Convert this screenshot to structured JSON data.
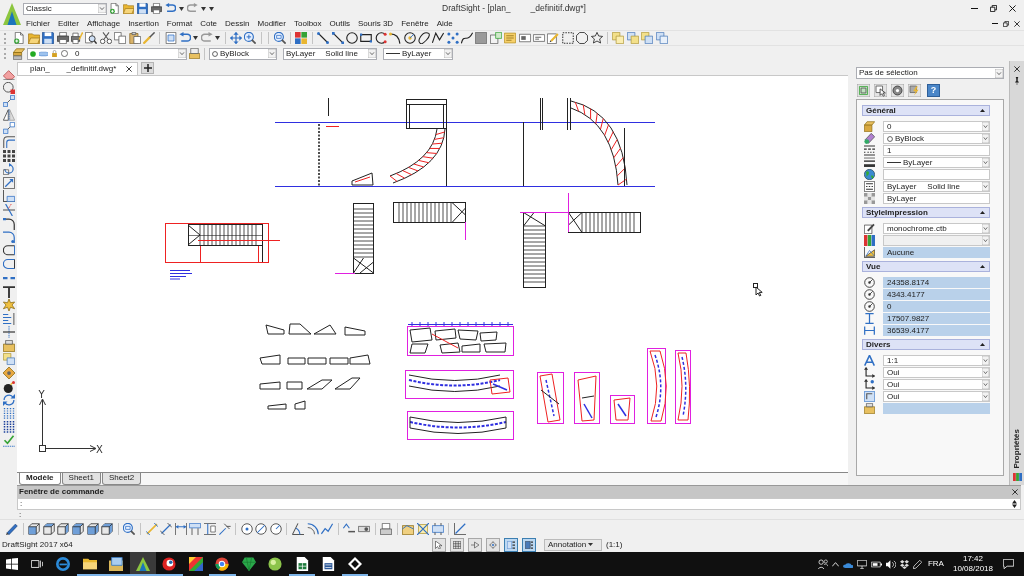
{
  "title_bar": {
    "workspace": "Classic",
    "title_start": "DraftSight - [plan_",
    "title_end": "_definitif.dwg*]"
  },
  "menu": [
    "Fichier",
    "Editer",
    "Affichage",
    "Insertion",
    "Format",
    "Cote",
    "Dessin",
    "Modifier",
    "Toolbox",
    "Outils",
    "Souris 3D",
    "Fenêtre",
    "Aide"
  ],
  "properties_toolbar": {
    "layer": "0",
    "ink": "ByBlock",
    "linetype": "ByLayer",
    "linetype_name": "Solid line",
    "lineweight": "ByLayer"
  },
  "document_tabs": [
    {
      "name_start": "plan_",
      "name_end": "_definitif.dwg*",
      "selected": true
    }
  ],
  "drawing": {
    "x_axis": "X",
    "y_axis": "Y"
  },
  "layout_tabs": [
    {
      "label": "Modèle",
      "selected": true
    },
    {
      "label": "Sheet1",
      "selected": false
    },
    {
      "label": "Sheet2",
      "selected": false
    }
  ],
  "properties_panel": {
    "selection": "Pas de sélection",
    "help_button": "?",
    "sections": [
      {
        "title": "Général",
        "expanded": true,
        "rows": [
          {
            "kind": "combo",
            "value": "0"
          },
          {
            "kind": "combo",
            "value": "ByBlock"
          },
          {
            "kind": "field",
            "value": "1"
          },
          {
            "kind": "combo",
            "value": "ByLayer"
          },
          {
            "kind": "field"
          },
          {
            "kind": "combo",
            "value": "ByLayer",
            "value_2": "Solid line"
          },
          {
            "kind": "field",
            "value": "ByLayer"
          }
        ]
      },
      {
        "title": "StyleImpression",
        "expanded": true,
        "rows": [
          {
            "kind": "combo",
            "value": "monochrome.ctb"
          },
          {
            "kind": "disabled"
          },
          {
            "kind": "readonly",
            "value": "Aucune"
          }
        ]
      },
      {
        "title": "Vue",
        "expanded": true,
        "rows": [
          {
            "kind": "readonly",
            "value": "24358.8174"
          },
          {
            "kind": "readonly",
            "value": "4343.4177"
          },
          {
            "kind": "readonly",
            "value": "0"
          },
          {
            "kind": "readonly",
            "value": "17507.9827"
          },
          {
            "kind": "readonly",
            "value": "36539.4177"
          }
        ]
      },
      {
        "title": "Divers",
        "expanded": true,
        "rows": [
          {
            "kind": "combo",
            "value": "1:1"
          },
          {
            "kind": "combo",
            "value": "Oui"
          },
          {
            "kind": "combo",
            "value": "Oui"
          },
          {
            "kind": "combo",
            "value": "Oui"
          },
          {
            "kind": "readonly"
          }
        ]
      }
    ],
    "tab_label": "Propriétés"
  },
  "command_window": {
    "title": "Fenêtre de commande",
    "prompts": [
      ":",
      ":"
    ]
  },
  "status_bar": {
    "version": "DraftSight 2017 x64",
    "toggles": [
      {
        "on": false
      },
      {
        "on": false
      },
      {
        "on": false
      },
      {
        "on": false
      },
      {
        "on": true
      },
      {
        "on": true
      }
    ],
    "annotation": "Annotation",
    "scale": "(1:1)"
  },
  "taskbar": {
    "apps": [
      {
        "running": false,
        "selected": false
      },
      {
        "running": true,
        "selected": false
      },
      {
        "running": true,
        "selected": false
      },
      {
        "running": true,
        "selected": true
      },
      {
        "running": true,
        "selected": false
      },
      {
        "running": false,
        "selected": false
      },
      {
        "running": true,
        "selected": false
      },
      {
        "running": false,
        "selected": false
      },
      {
        "running": false,
        "selected": false
      },
      {
        "running": true,
        "selected": false
      },
      {
        "running": false,
        "selected": false
      },
      {
        "running": true,
        "selected": false
      }
    ],
    "language": "FRA",
    "time": "17:42",
    "date": "10/08/2018"
  }
}
